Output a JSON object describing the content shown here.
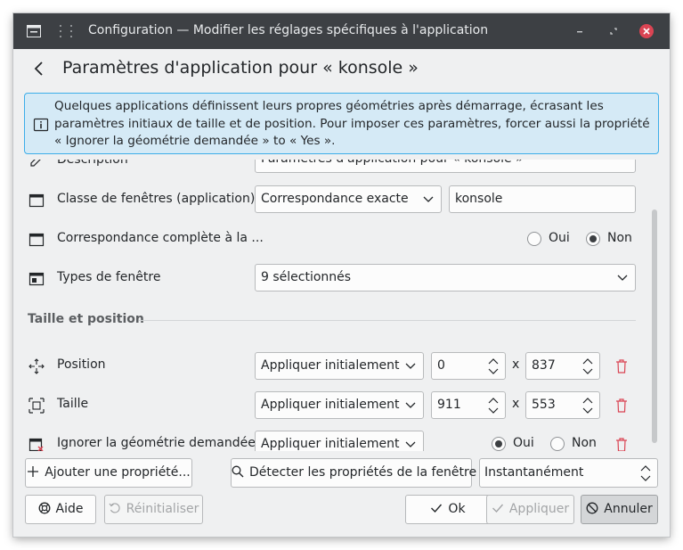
{
  "window": {
    "title": "Configuration — Modifier les réglages spécifiques à l'application"
  },
  "header": {
    "title": "Paramètres d'application pour « konsole »"
  },
  "banner": {
    "text": "Quelques applications définissent leurs propres géométries après démarrage, écrasant les paramètres initiaux de taille et de position. Pour imposer ces paramètres, forcer aussi la propriété « Ignorer la géométrie demandée » to « Yes »."
  },
  "rows": {
    "description": {
      "label": "Description",
      "value": "Paramètres d'application pour « konsole »"
    },
    "window_class": {
      "label": "Classe de fenêtres (application)",
      "match": "Correspondance exacte",
      "value": "konsole"
    },
    "full_match": {
      "label": "Correspondance complète à la ...",
      "yes": "Oui",
      "no": "Non",
      "selected": "Non"
    },
    "window_types": {
      "label": "Types de fenêtre",
      "value": "9 sélectionnés"
    }
  },
  "section": {
    "title": "Taille et position"
  },
  "position": {
    "label": "Position",
    "policy": "Appliquer initialement",
    "x": "0",
    "sep": "x",
    "y": "837"
  },
  "size": {
    "label": "Taille",
    "policy": "Appliquer initialement",
    "width": "911",
    "sep": "x",
    "height": "553"
  },
  "ignore_geometry": {
    "label": "Ignorer la géométrie demandée",
    "policy": "Appliquer initialement",
    "yes": "Oui",
    "no": "Non",
    "selected": "Oui"
  },
  "actions": {
    "add_property": "Ajouter une propriété...",
    "detect": "Détecter les propriétés de la fenêtre",
    "delay": "Instantanément"
  },
  "buttons": {
    "help": "Aide",
    "reset": "Réinitialiser",
    "ok": "Ok",
    "apply": "Appliquer",
    "cancel": "Annuler"
  },
  "colors": {
    "titlebar": "#3d4044",
    "background": "#eff0f1",
    "accent": "#3daee9",
    "banner_bg": "#d5eaf6",
    "close": "#da4453",
    "trash": "#da4453"
  }
}
